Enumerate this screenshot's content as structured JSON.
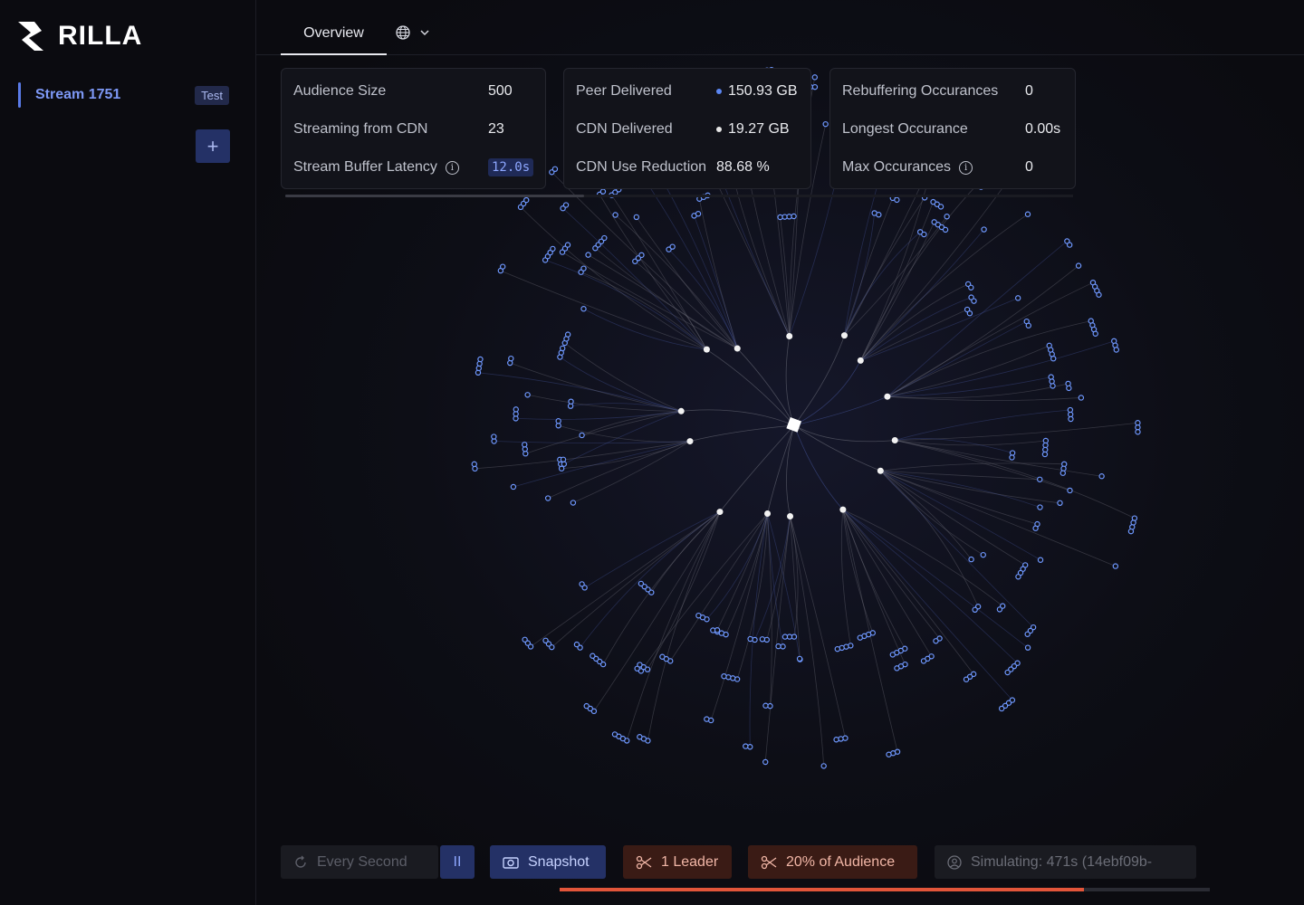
{
  "app": {
    "logo_text": "RILLA"
  },
  "sidebar": {
    "stream": {
      "name": "Stream 1751",
      "badge": "Test"
    },
    "add_label": "+"
  },
  "tabs": {
    "overview": "Overview"
  },
  "stats": {
    "audience": [
      {
        "label": "Audience Size",
        "value": "500"
      },
      {
        "label": "Streaming from CDN",
        "value": "23"
      },
      {
        "label": "Stream Buffer Latency",
        "value": "12.0s"
      }
    ],
    "delivery": [
      {
        "label": "Peer Delivered",
        "value": "150.93 GB"
      },
      {
        "label": "CDN Delivered",
        "value": "19.27 GB"
      },
      {
        "label": "CDN Use Reduction",
        "value": "88.68 %"
      }
    ],
    "rebuffer": [
      {
        "label": "Rebuffering Occurances",
        "value": "0"
      },
      {
        "label": "Longest Occurance",
        "value": "0.00s"
      },
      {
        "label": "Max Occurances",
        "value": "0"
      }
    ]
  },
  "controls": {
    "every": "Every Second",
    "pause": "II",
    "snapshot": "Snapshot",
    "leader": "1 Leader",
    "audience": "20% of Audience",
    "simulating": "Simulating: 471s (14ebf09b-",
    "progress": 0.807
  },
  "colors": {
    "accent": "#5a7be8",
    "peer_dot": "#5b86f2",
    "cdn_dot": "#e6e6e6",
    "danger": "#e2553a",
    "node": "#6f98ff"
  }
}
